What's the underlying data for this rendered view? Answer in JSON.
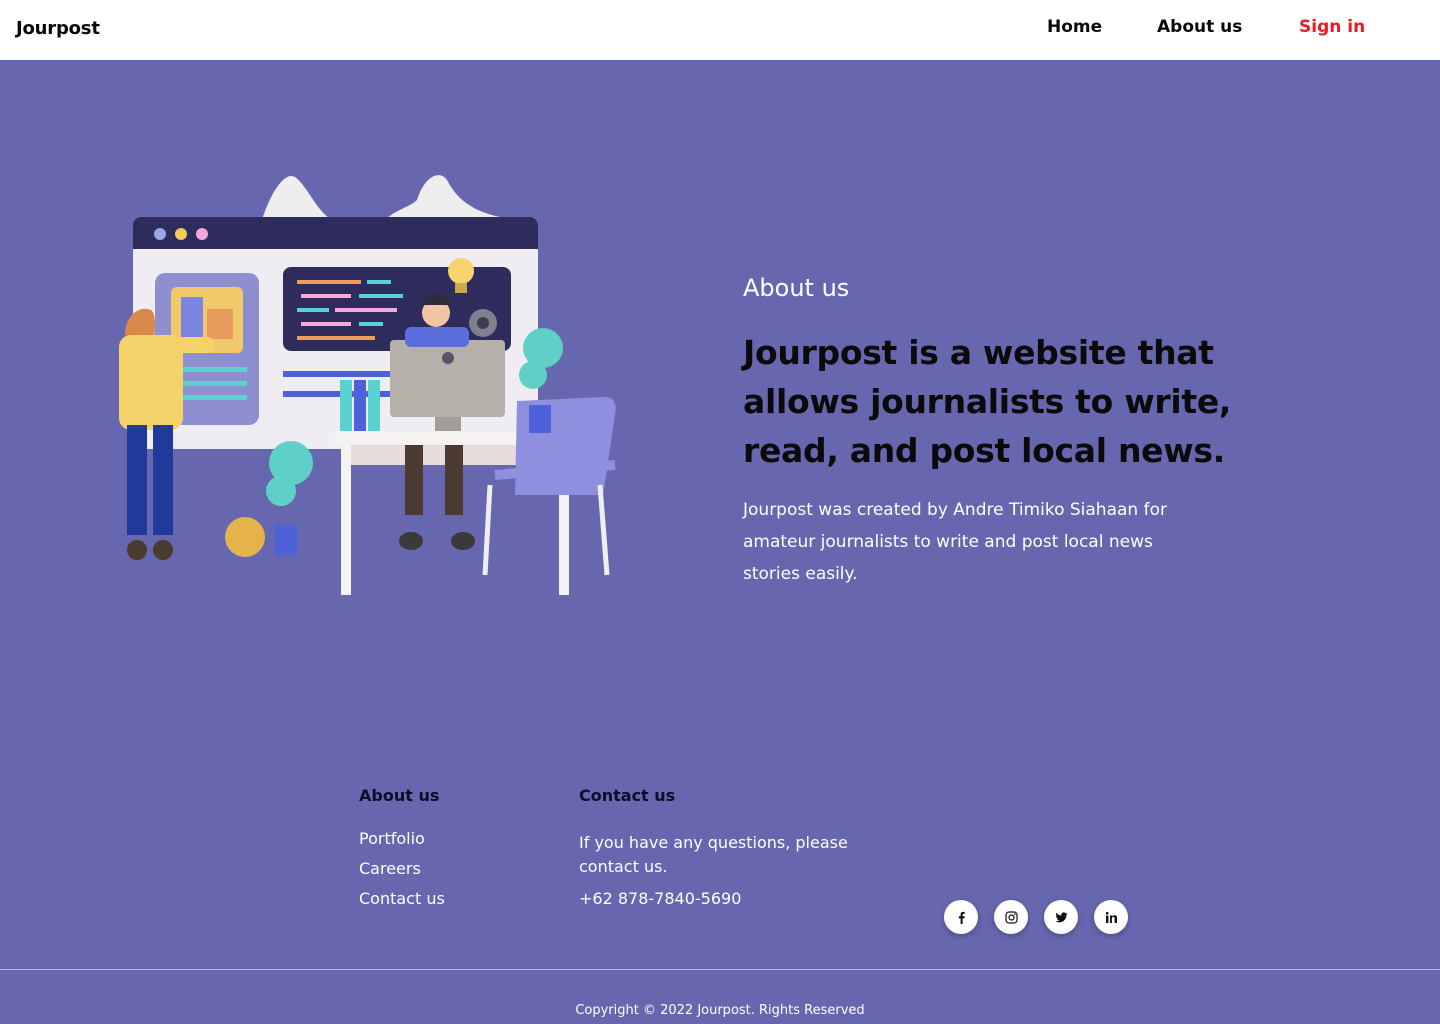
{
  "header": {
    "brand": "Jourpost",
    "nav": {
      "home": "Home",
      "about": "About us",
      "signin": "Sign in"
    },
    "signin_color": "#ea1b23"
  },
  "hero": {
    "eyebrow": "About us",
    "headline": "Jourpost is a website that allows journalists to write, read, and post local news.",
    "description": "Jourpost was created by Andre Timiko Siahaan for amateur journalists to write and post local news stories easily.",
    "illustration_icon": "office-workers-illustration"
  },
  "footer": {
    "about": {
      "title": "About us",
      "links": [
        "Portfolio",
        "Careers",
        "Contact us"
      ]
    },
    "contact": {
      "title": "Contact us",
      "text": "If you have any questions, please contact us.",
      "phone": "+62 878-7840-5690"
    },
    "social": [
      "facebook-icon",
      "instagram-icon",
      "twitter-icon",
      "linkedin-icon"
    ],
    "copyright": "Copyright © 2022 Jourpost. Rights Reserved"
  },
  "colors": {
    "background": "#6667ae",
    "header": "#ffffff",
    "accent_red": "#ea1b23"
  }
}
